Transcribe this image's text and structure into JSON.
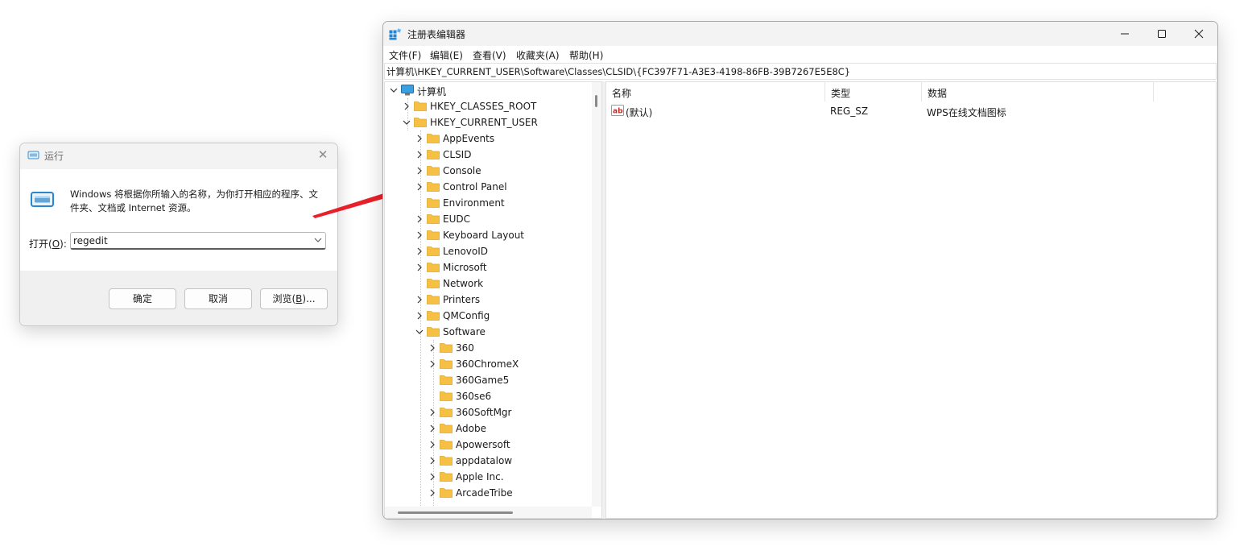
{
  "run_dialog": {
    "title": "运行",
    "description": "Windows 将根据你所输入的名称，为你打开相应的程序、文件夹、文档或 Internet 资源。",
    "open_label_prefix": "打开(",
    "open_label_key": "O",
    "open_label_suffix": "):",
    "input_value": "regedit",
    "ok_label": "确定",
    "cancel_label": "取消",
    "browse_prefix": "浏览(",
    "browse_key": "B",
    "browse_suffix": ")..."
  },
  "regedit": {
    "title": "注册表编辑器",
    "menu": [
      "文件(F)",
      "编辑(E)",
      "查看(V)",
      "收藏夹(A)",
      "帮助(H)"
    ],
    "address": "计算机\\HKEY_CURRENT_USER\\Software\\Classes\\CLSID\\{FC397F71-A3E3-4198-86FB-39B7267E5E8C}",
    "tree": {
      "root": "计算机",
      "hives": [
        "HKEY_CLASSES_ROOT",
        "HKEY_CURRENT_USER"
      ],
      "hkcu_children": [
        "AppEvents",
        "CLSID",
        "Console",
        "Control Panel",
        "Environment",
        "EUDC",
        "Keyboard Layout",
        "LenovoID",
        "Microsoft",
        "Network",
        "Printers",
        "QMConfig",
        "Software"
      ],
      "software_children": [
        "360",
        "360ChromeX",
        "360Game5",
        "360se6",
        "360SoftMgr",
        "Adobe",
        "Apowersoft",
        "appdatalow",
        "Apple Inc.",
        "ArcadeTribe"
      ]
    },
    "columns": {
      "name": "名称",
      "type": "类型",
      "data": "数据"
    },
    "values": [
      {
        "name": "(默认)",
        "type": "REG_SZ",
        "data": "WPS在线文档图标"
      }
    ]
  },
  "colors": {
    "arrow": "#e8202a",
    "folder": "#f5c043",
    "folder_dark": "#e0a82c",
    "accent": "#1f87d6"
  }
}
